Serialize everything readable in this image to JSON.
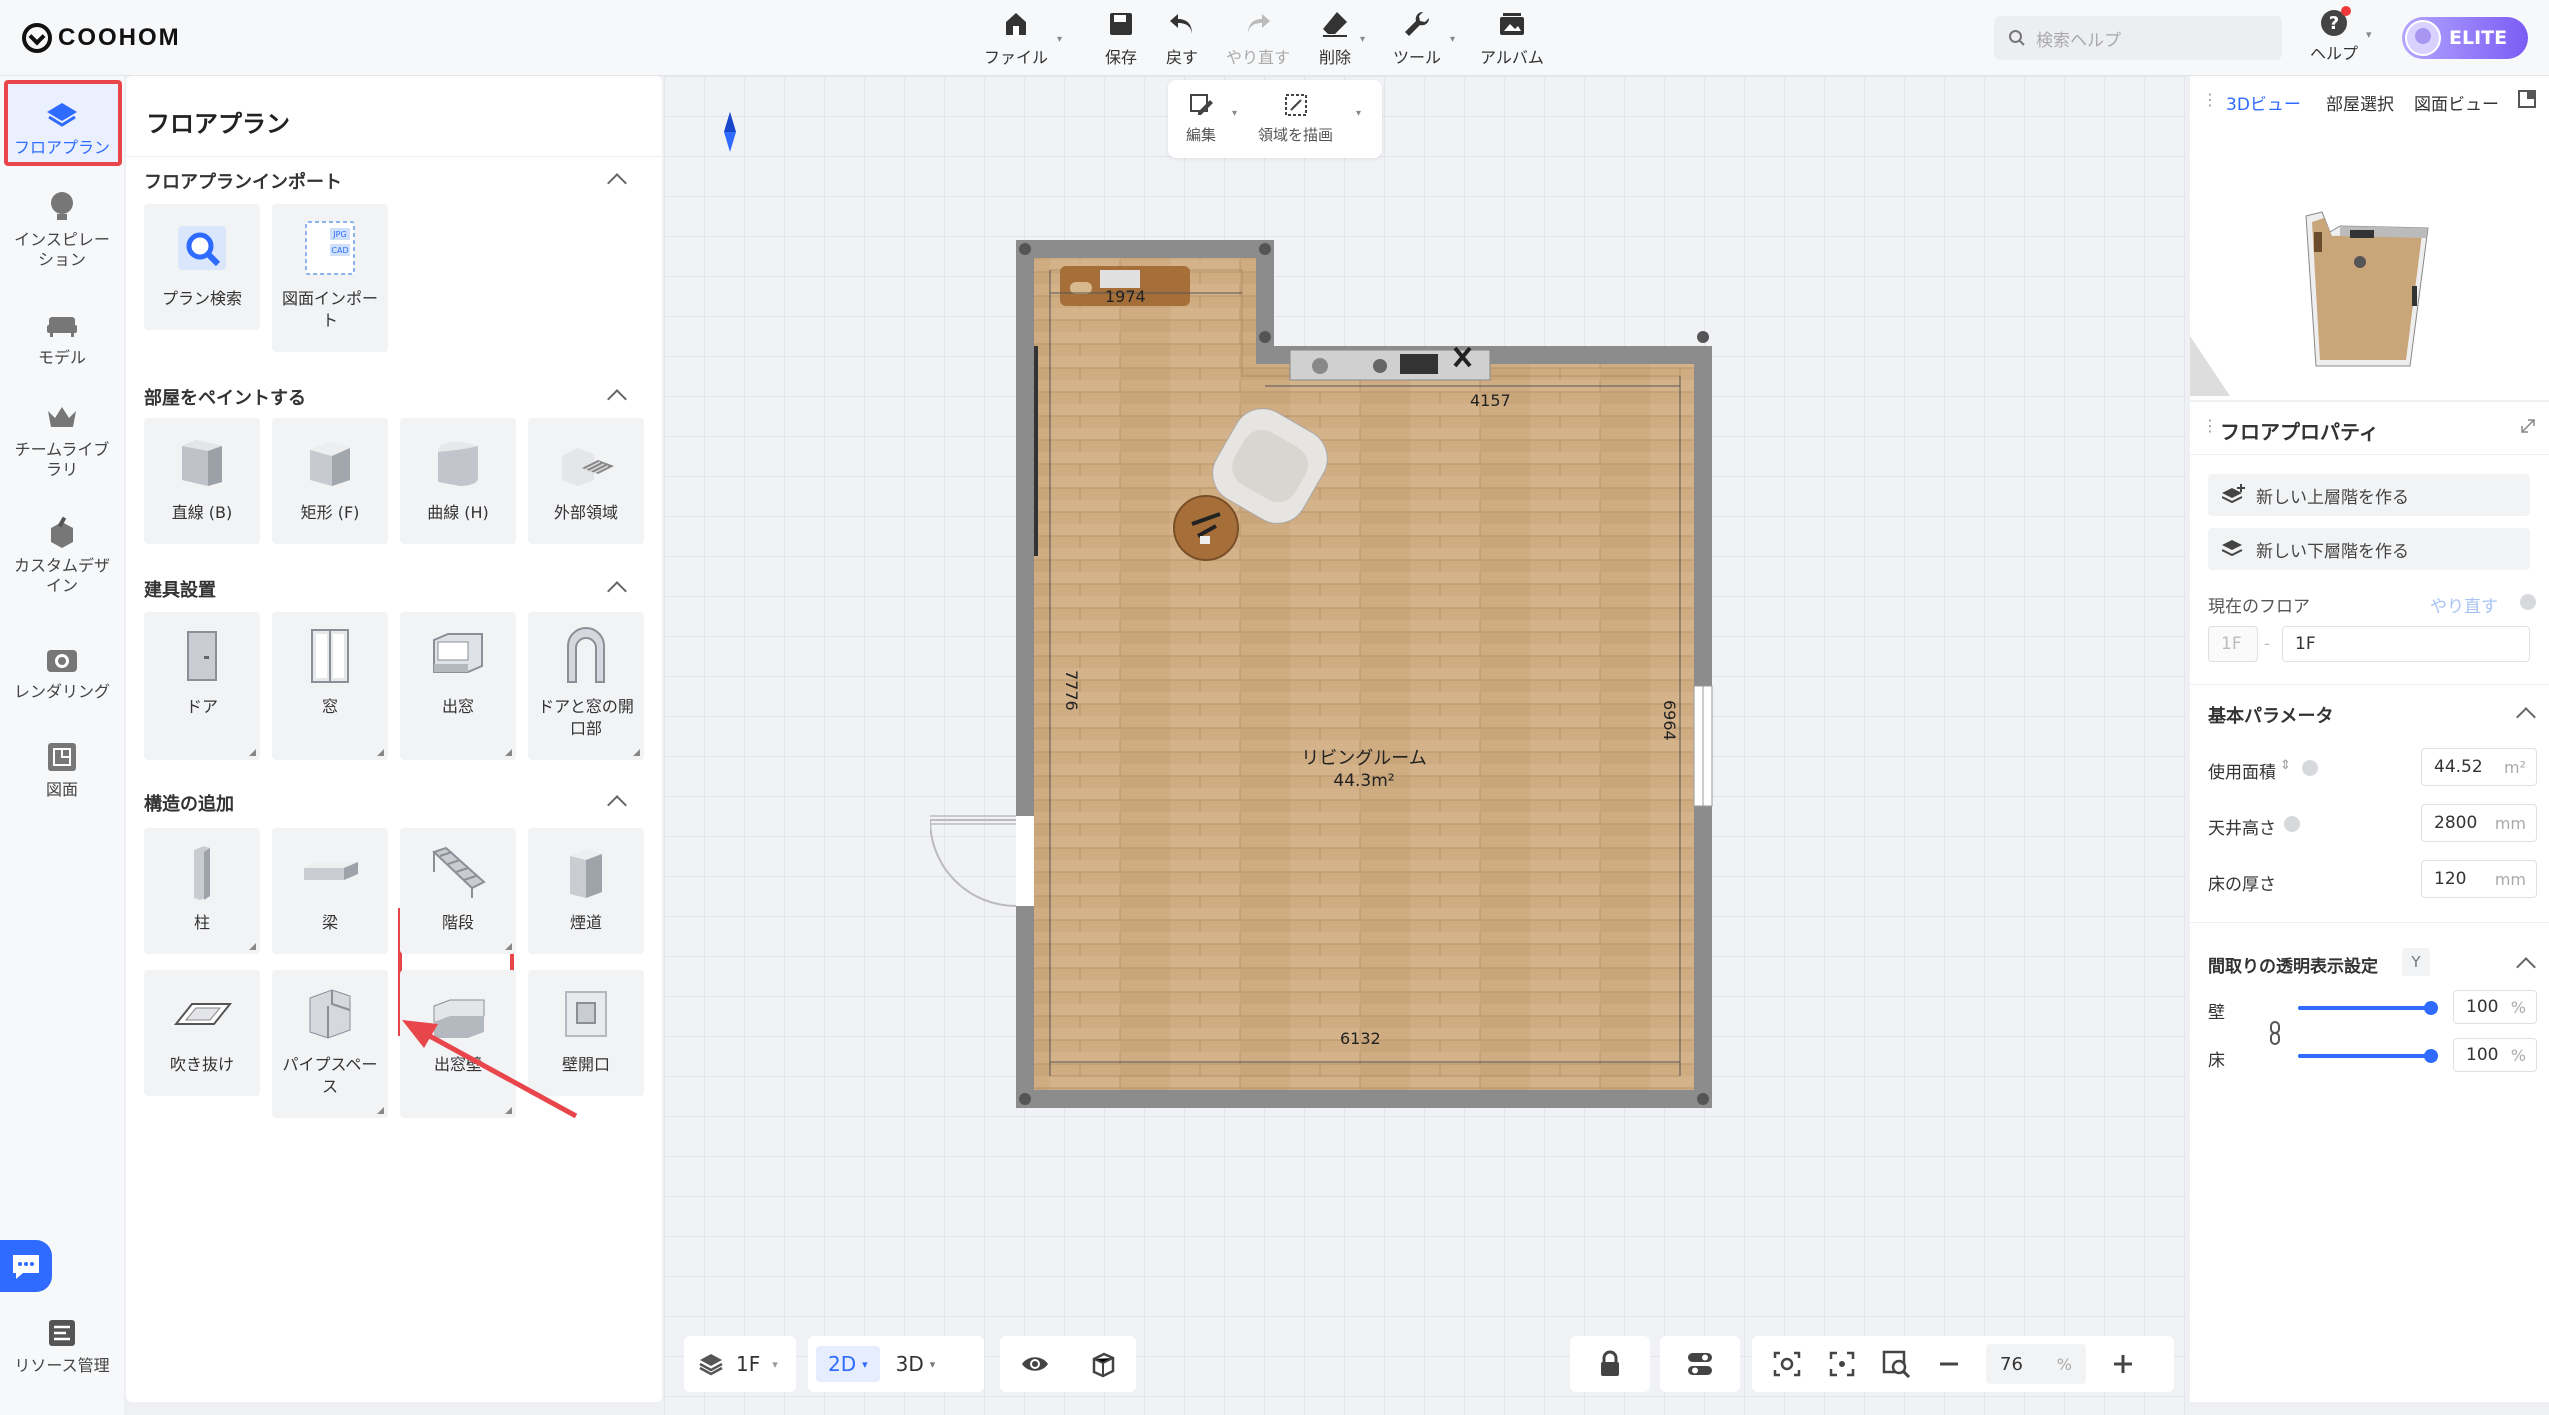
{
  "app": {
    "name": "COOHOM"
  },
  "toolbar": {
    "file": "ファイル",
    "save": "保存",
    "undo": "戻す",
    "redo": "やり直す",
    "delete": "削除",
    "tools": "ツール",
    "album": "アルバム"
  },
  "search": {
    "placeholder": "検索ヘルプ"
  },
  "help": {
    "label": "ヘルプ"
  },
  "account": {
    "badge": "ELITE"
  },
  "rail": {
    "floorplan": "フロアプラン",
    "inspiration": "インスピレーション",
    "model": "モデル",
    "team_library": "チームライブラリ",
    "custom_design": "カスタムデザイン",
    "rendering": "レンダリング",
    "drawing": "図面",
    "resource": "リソース管理"
  },
  "panel": {
    "title": "フロアプラン",
    "import": {
      "title": "フロアプランインポート",
      "items": [
        "プラン検索",
        "図面インポート"
      ],
      "file_labels": [
        "JPG",
        "CAD"
      ]
    },
    "paint": {
      "title": "部屋をペイントする",
      "items": [
        "直線 (B)",
        "矩形 (F)",
        "曲線 (H)",
        "外部領域"
      ]
    },
    "fixtures": {
      "title": "建具設置",
      "items": [
        "ドア",
        "窓",
        "出窓",
        "ドアと窓の開口部"
      ]
    },
    "structure": {
      "title": "構造の追加",
      "items": [
        "柱",
        "梁",
        "階段",
        "煙道",
        "吹き抜け",
        "パイプスペース",
        "出窓壁",
        "壁開口"
      ]
    }
  },
  "editbar": {
    "edit": "編集",
    "draw_area": "領域を描画"
  },
  "floorplan": {
    "room_name": "リビングルーム",
    "room_area": "44.3m²",
    "dim_top_left": "1974",
    "dim_top_right": "4157",
    "dim_left": "7776",
    "dim_right": "6964",
    "dim_bottom": "6132"
  },
  "view_tabs": {
    "view3d": "3Dビュー",
    "room_select": "部屋選択",
    "plan_view": "図面ビュー"
  },
  "props": {
    "title": "フロアプロパティ",
    "new_upper": "新しい上層階を作る",
    "new_lower": "新しい下層階を作る",
    "current_floor": "現在のフロア",
    "redo": "やり直す",
    "floor_prefix": "1F",
    "floor_name": "1F",
    "basic_params": "基本パラメータ",
    "area_label": "使用面積",
    "area_value": "44.52",
    "area_unit": "m²",
    "ceiling_label": "天井高さ",
    "ceiling_value": "2800",
    "ceiling_unit": "mm",
    "floor_thick_label": "床の厚さ",
    "floor_thick_value": "120",
    "floor_thick_unit": "mm",
    "transparency_title": "間取りの透明表示設定",
    "transparency_key": "Y",
    "wall_label": "壁",
    "wall_value": "100",
    "floor_label": "床",
    "floor_value": "100",
    "pct": "%"
  },
  "bottombar": {
    "floor": "1F",
    "mode2d": "2D",
    "mode3d": "3D",
    "zoom": "76",
    "zoom_unit": "%"
  },
  "colors": {
    "accent": "#2f6bff",
    "highlight": "#e8464a",
    "wall": "#8c8c8c",
    "wood": "#c9a57a"
  }
}
